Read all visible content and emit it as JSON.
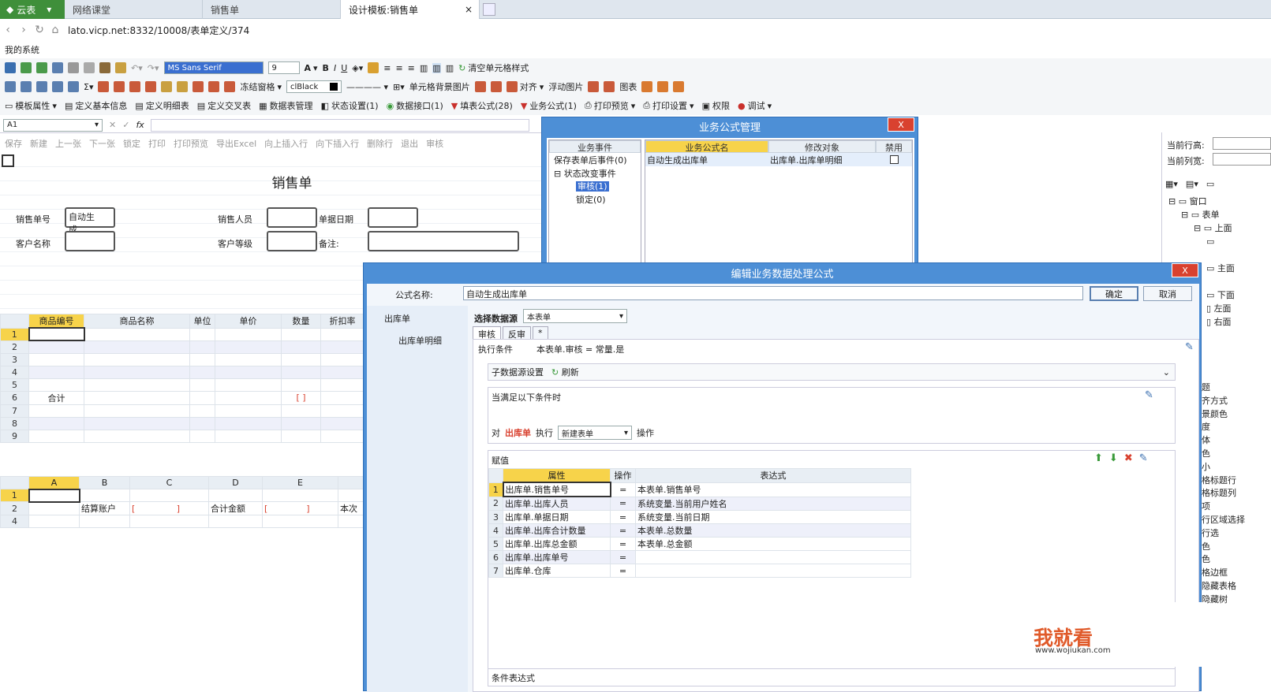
{
  "tabs": {
    "logo": "云表",
    "tab1": "网络课堂",
    "tab2": "销售单",
    "tab3": "设计模板:销售单"
  },
  "address": {
    "url": "lato.vicp.net:8332/10008/表单定义/374"
  },
  "bookmark": "我的系统",
  "toolbar1": {
    "font": "MS Sans Serif",
    "size": "9",
    "clear_style": "清空单元格样式"
  },
  "toolbar2": {
    "freeze": "冻结窗格",
    "color": "clBlack",
    "cell_bg": "单元格背景图片",
    "align": "对齐",
    "float_img": "浮动图片",
    "chart": "图表"
  },
  "toolbar3": {
    "template_props": "模板属性",
    "define_basic": "定义基本信息",
    "define_detail": "定义明细表",
    "define_cross": "定义交叉表",
    "data_mgmt": "数据表管理",
    "state_set": "状态设置(1)",
    "data_iface": "数据接口(1)",
    "fill_formula": "填表公式(28)",
    "biz_formula": "业务公式(1)",
    "print_preview": "打印预览",
    "print_set": "打印设置",
    "perm": "权限",
    "debug": "调试"
  },
  "formula": {
    "cell_ref": "A1"
  },
  "sheet_toolbar": [
    "保存",
    "新建",
    "上一张",
    "下一张",
    "锁定",
    "打印",
    "打印预览",
    "导出Excel",
    "向上插入行",
    "向下插入行",
    "删除行",
    "退出",
    "审核"
  ],
  "form": {
    "title": "销售单",
    "order_no_label": "销售单号",
    "order_no_value": "自动生成...",
    "salesperson_label": "销售人员",
    "date_label": "单据日期",
    "customer_label": "客户名称",
    "level_label": "客户等级",
    "remark_label": "备注:"
  },
  "detail_grid": {
    "headers": [
      "商品编号",
      "商品名称",
      "单位",
      "单价",
      "数量",
      "折扣率"
    ],
    "rows": [
      "1",
      "2",
      "3",
      "4",
      "5",
      "6",
      "7",
      "8",
      "9"
    ],
    "total_label": "合计"
  },
  "bottom_grid": {
    "cols": [
      "A",
      "B",
      "C",
      "D",
      "E"
    ],
    "rows": [
      "1",
      "2",
      "4"
    ],
    "settle_label": "结算账户",
    "total_amt_label": "合计金额",
    "this_label": "本次"
  },
  "right_panel": {
    "row_height": "当前行高:",
    "col_width": "当前列宽:",
    "tree": [
      "窗口",
      "表单",
      "上面",
      "主面",
      "下面",
      "左面",
      "右面"
    ],
    "props": [
      "题",
      "齐方式",
      "景颜色",
      "度",
      "体",
      "色",
      "小",
      "格标题行",
      "格标题列",
      "项",
      "行区域选择",
      "行选",
      "色",
      "色",
      "格边框",
      "隐藏表格",
      "隐藏树"
    ]
  },
  "dialog1": {
    "title": "业务公式管理",
    "close": "X",
    "col_event": "业务事件",
    "col_name": "业务公式名",
    "col_target": "修改对象",
    "col_disable": "禁用",
    "tree": [
      "保存表单后事件(0)",
      "状态改变事件",
      "审核(1)",
      "锁定(0)"
    ],
    "row_name": "自动生成出库单",
    "row_target": "出库单.出库单明细"
  },
  "dialog2": {
    "title": "编辑业务数据处理公式",
    "close": "X",
    "name_label": "公式名称:",
    "name_value": "自动生成出库单",
    "ok": "确定",
    "cancel": "取消",
    "left_items": [
      "出库单",
      "出库单明细"
    ],
    "ds_label": "选择数据源",
    "ds_value": "本表单",
    "tabs": [
      "审核",
      "反审",
      "*"
    ],
    "cond_label": "执行条件",
    "cond_value": "本表单.审核 = 常量.是",
    "sub_ds": "子数据源设置",
    "refresh": "刷新",
    "when_label": "当满足以下条件时",
    "action_pre": "对",
    "action_target": "出库单",
    "action_mid": "执行",
    "action_value": "新建表单",
    "action_post": "操作",
    "assign_label": "赋值",
    "assign_headers": [
      "属性",
      "操作",
      "表达式"
    ],
    "assign_rows": [
      {
        "n": "1",
        "attr": "出库单.销售单号",
        "op": "=",
        "expr": "本表单.销售单号"
      },
      {
        "n": "2",
        "attr": "出库单.出库人员",
        "op": "=",
        "expr": "系统变量.当前用户姓名"
      },
      {
        "n": "3",
        "attr": "出库单.单据日期",
        "op": "=",
        "expr": "系统变量.当前日期"
      },
      {
        "n": "4",
        "attr": "出库单.出库合计数量",
        "op": "=",
        "expr": "本表单.总数量"
      },
      {
        "n": "5",
        "attr": "出库单.出库总金额",
        "op": "=",
        "expr": "本表单.总金额"
      },
      {
        "n": "6",
        "attr": "出库单.出库单号",
        "op": "=",
        "expr": ""
      },
      {
        "n": "7",
        "attr": "出库单.仓库",
        "op": "=",
        "expr": ""
      }
    ],
    "cond_expr_label": "条件表达式"
  },
  "watermark": {
    "brand": "我就看",
    "url": "www.wojiukan.com"
  },
  "colors": {
    "dialog_blue": "#4d8fd6",
    "header_yellow": "#f7d34a",
    "tab_green": "#3f8f3a",
    "red": "#d9412f"
  }
}
